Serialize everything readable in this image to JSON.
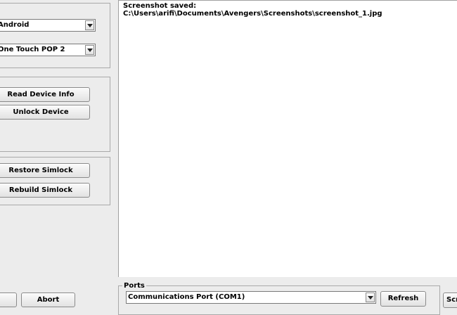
{
  "left_panel": {
    "platform_select": {
      "value": "Android"
    },
    "model_select": {
      "value": "One Touch POP 2"
    },
    "read_device_info_label": "Read Device Info",
    "unlock_device_label": "Unlock Device",
    "restore_simlock_label": "Restore Simlock",
    "rebuild_simlock_label": "Rebuild Simlock",
    "abort_label": "Abort"
  },
  "log": {
    "lines": [
      "Screenshot saved:",
      "C:\\Users\\arifi\\Documents\\Avengers\\Screenshots\\screenshot_1.jpg"
    ]
  },
  "ports": {
    "legend": "Ports",
    "port_select": {
      "value": "Communications Port (COM1)"
    },
    "refresh_label": "Refresh",
    "screenshot_label": "Scr"
  }
}
